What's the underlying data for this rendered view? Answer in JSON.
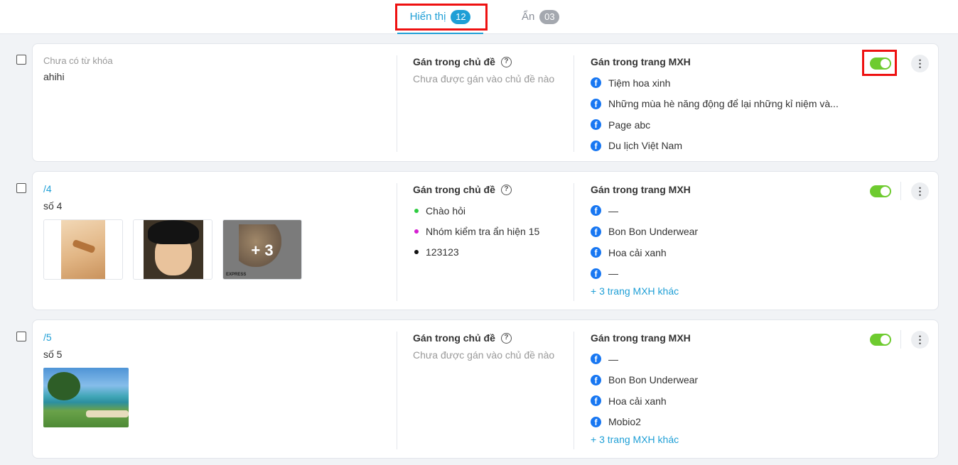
{
  "tabs": [
    {
      "label": "Hiển thị",
      "count": "12",
      "active": true
    },
    {
      "label": "Ẩn",
      "count": "03",
      "active": false
    }
  ],
  "cards": [
    {
      "keyword_empty": "Chưa có từ khóa",
      "keyword_link": "",
      "title": "ahihi",
      "topics_heading": "Gán trong chủ đề",
      "topics_empty": "Chưa được gán vào chủ đề nào",
      "topics": [],
      "pages_heading": "Gán trong trang MXH",
      "pages": [
        "Tiệm hoa xinh",
        "Những mùa hè năng động để lại những kỉ niệm và...",
        "Page abc",
        "Du lịch Việt Nam"
      ],
      "more_pages": "",
      "enabled": true
    },
    {
      "keyword_empty": "",
      "keyword_link": "/4",
      "title": "số 4",
      "topics_heading": "Gán trong chủ đề",
      "topics_empty": "",
      "topics": [
        {
          "label": "Chào hỏi",
          "color": "#2ecc40"
        },
        {
          "label": "Nhóm kiểm tra ẩn hiện 15",
          "color": "#d51fd1"
        },
        {
          "label": "123123",
          "color": "#111111"
        }
      ],
      "pages_heading": "Gán trong trang MXH",
      "pages": [
        "—",
        "Bon Bon Underwear",
        "Hoa cải xanh",
        "—"
      ],
      "more_pages": "+ 3 trang MXH khác",
      "images_more": "+ 3",
      "images_brand": "EXPRESS",
      "enabled": true
    },
    {
      "keyword_empty": "",
      "keyword_link": "/5",
      "title": "số 5",
      "topics_heading": "Gán trong chủ đề",
      "topics_empty": "Chưa được gán vào chủ đề nào",
      "topics": [],
      "pages_heading": "Gán trong trang MXH",
      "pages": [
        "—",
        "Bon Bon Underwear",
        "Hoa cải xanh",
        "Mobio2"
      ],
      "more_pages": "+ 3 trang MXH khác",
      "enabled": true
    }
  ],
  "icons": {
    "help": "?",
    "more": "⋮",
    "facebook": "f"
  },
  "colors": {
    "accent": "#1f9fd6",
    "toggle_on": "#6ecb2f",
    "highlight": "#ee1111"
  }
}
